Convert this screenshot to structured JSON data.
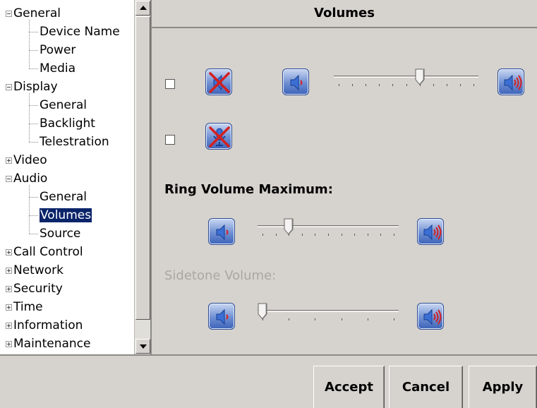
{
  "tree": {
    "items": [
      {
        "label": "General",
        "expander": "minus",
        "level": 0
      },
      {
        "label": "Device Name",
        "level": 1
      },
      {
        "label": "Power",
        "level": 1
      },
      {
        "label": "Media",
        "level": 1
      },
      {
        "label": "Display",
        "expander": "minus",
        "level": 0
      },
      {
        "label": "General",
        "level": 1
      },
      {
        "label": "Backlight",
        "level": 1
      },
      {
        "label": "Telestration",
        "level": 1
      },
      {
        "label": "Video",
        "expander": "plus",
        "level": 0
      },
      {
        "label": "Audio",
        "expander": "minus",
        "level": 0
      },
      {
        "label": "General",
        "level": 1
      },
      {
        "label": "Volumes",
        "level": 1,
        "selected": true
      },
      {
        "label": "Source",
        "level": 1
      },
      {
        "label": "Call Control",
        "expander": "plus",
        "level": 0
      },
      {
        "label": "Network",
        "expander": "plus",
        "level": 0
      },
      {
        "label": "Security",
        "expander": "plus",
        "level": 0
      },
      {
        "label": "Time",
        "expander": "plus",
        "level": 0
      },
      {
        "label": "Information",
        "expander": "plus",
        "level": 0
      },
      {
        "label": "Maintenance",
        "expander": "plus",
        "level": 0
      }
    ]
  },
  "content": {
    "title": "Volumes",
    "speaker_mute": {
      "checked": false,
      "icon": "speaker-muted-icon"
    },
    "speaker_volume": {
      "value": 0.6,
      "min_icon": "volume-low-icon",
      "max_icon": "volume-high-icon"
    },
    "mic_mute": {
      "checked": false,
      "icon": "microphone-muted-icon"
    },
    "ring_volume": {
      "label": "Ring Volume Maximum:",
      "value": 0.2
    },
    "sidetone_volume": {
      "label": "Sidetone Volume:",
      "value": 0.0,
      "disabled": true
    }
  },
  "footer": {
    "accept_label": "Accept",
    "cancel_label": "Cancel",
    "apply_label": "Apply"
  },
  "colors": {
    "selection": "#0a246a",
    "panel": "#d6d3ce",
    "icon_blue": "#3d63b8",
    "mute_red": "#d42020"
  }
}
